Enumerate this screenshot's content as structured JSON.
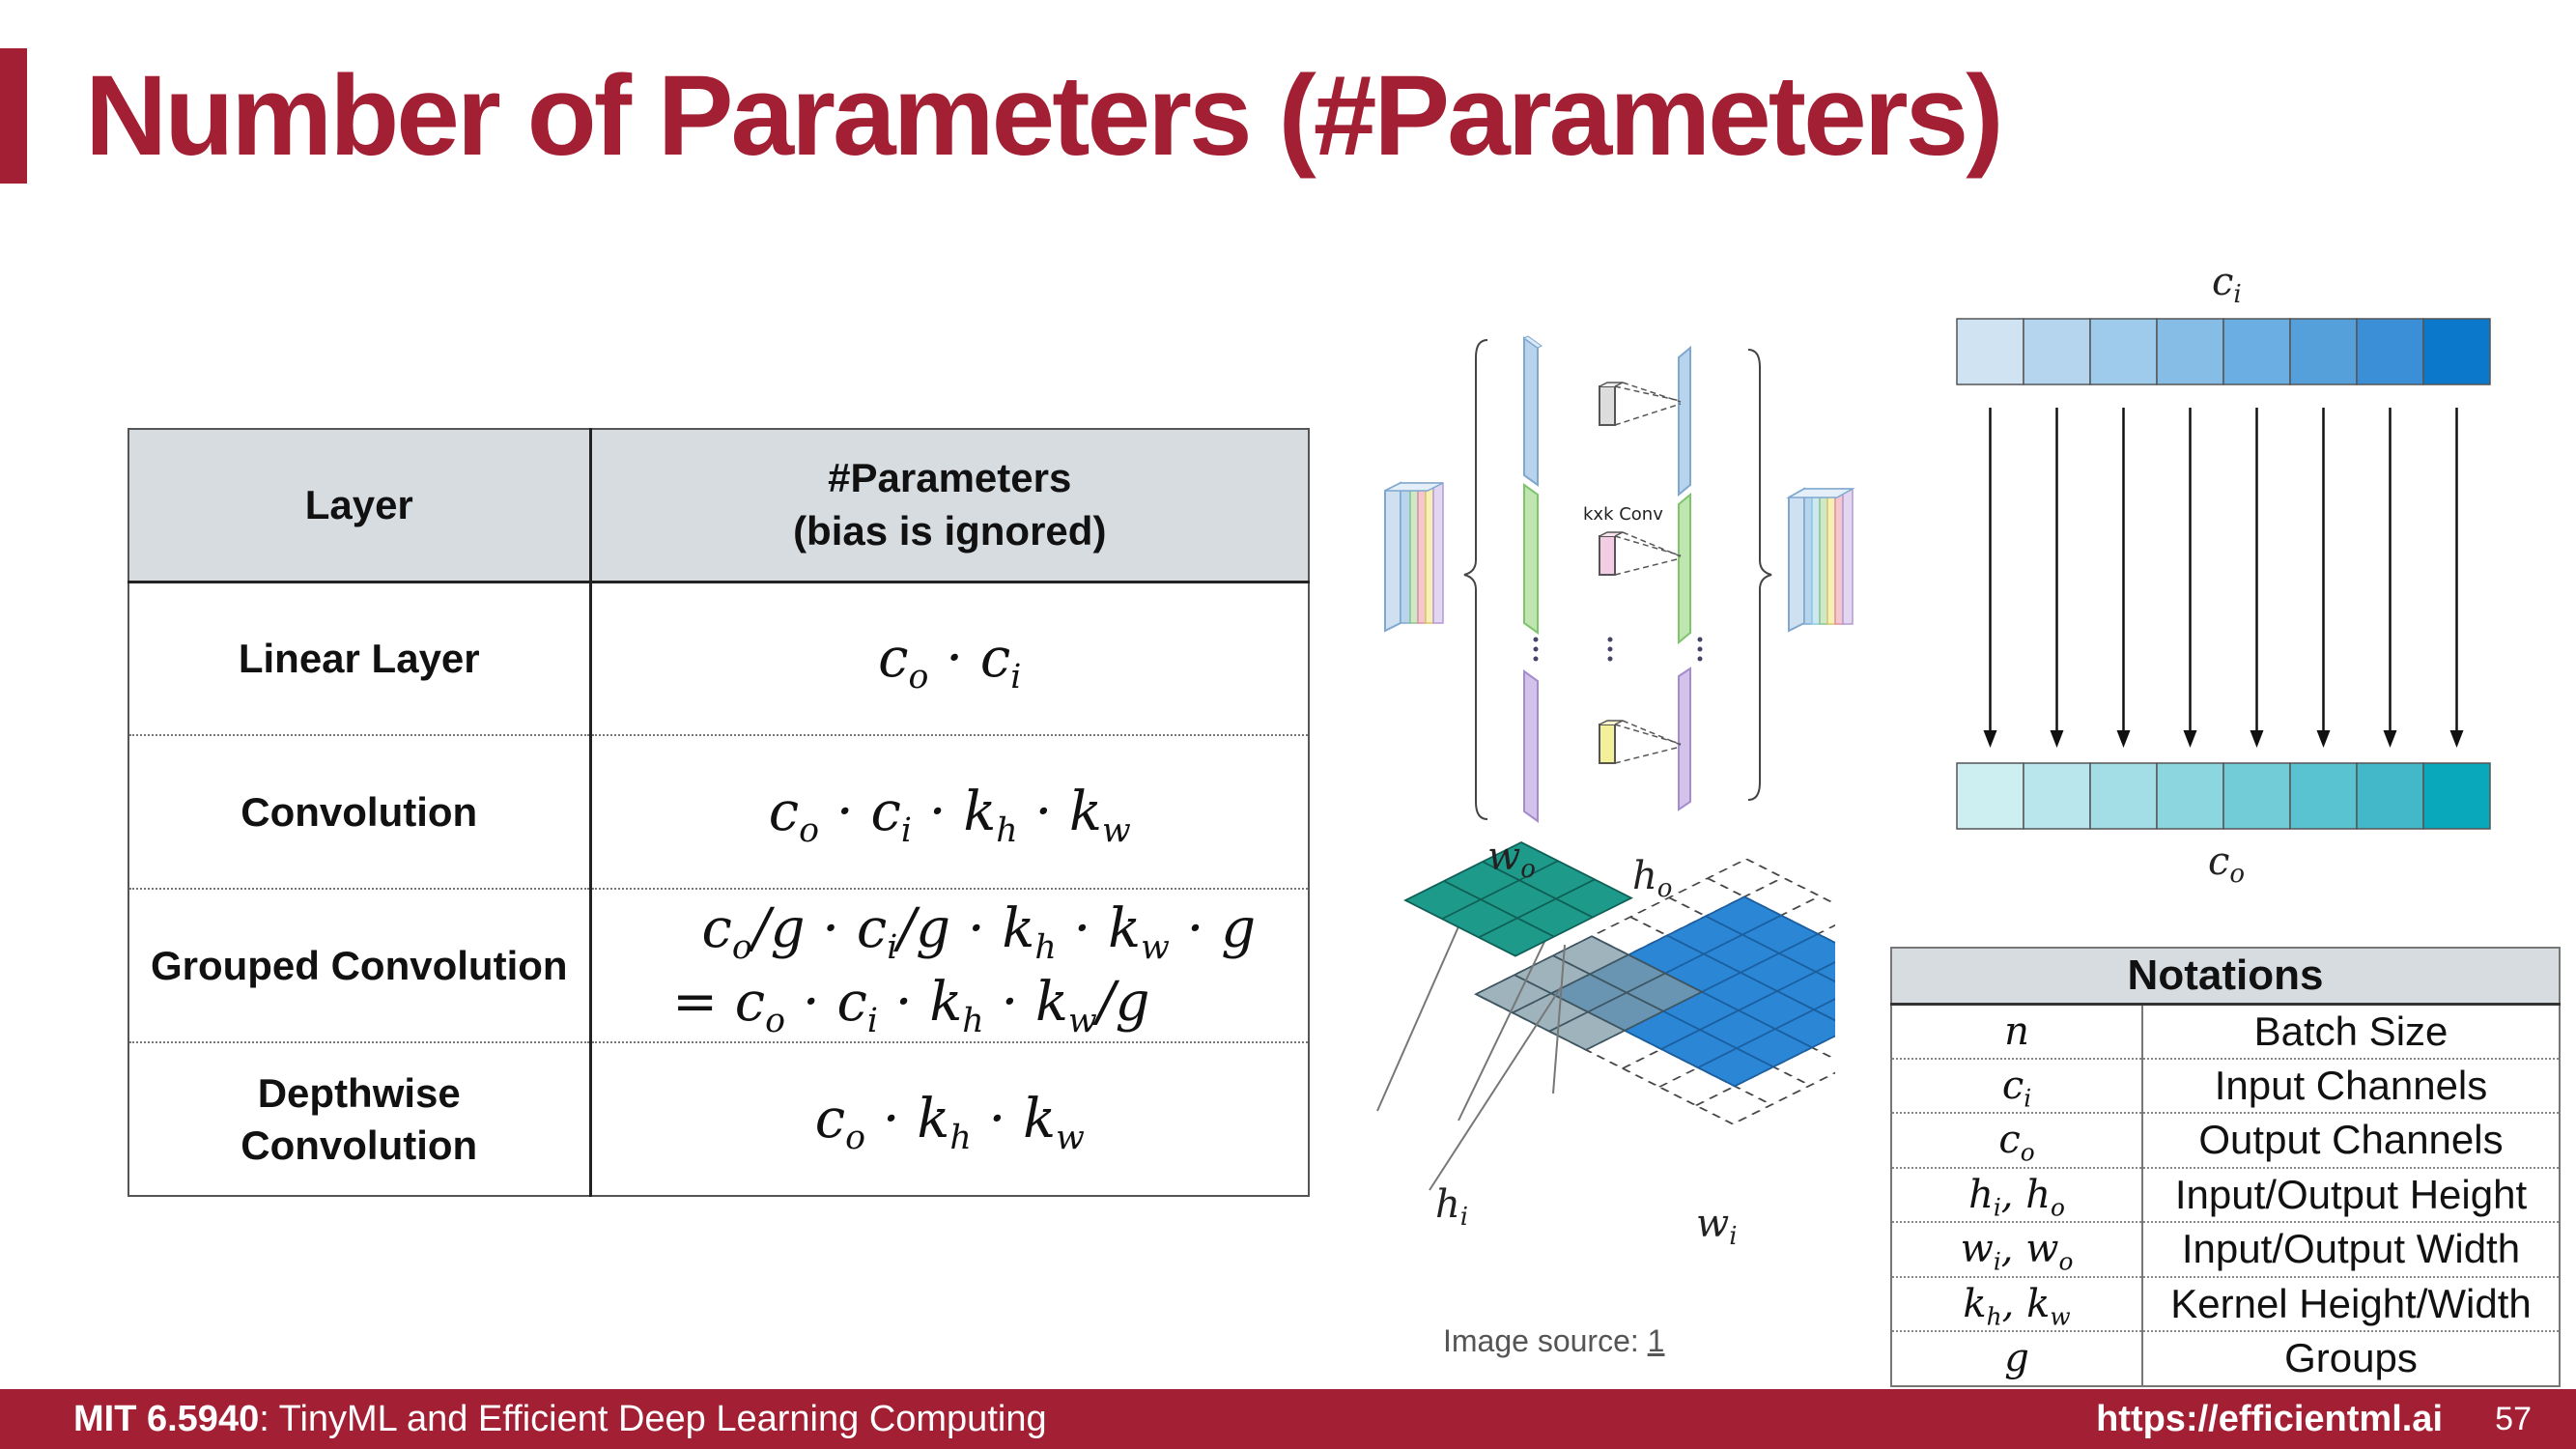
{
  "slide": {
    "title": "Number of Parameters (#Parameters)",
    "accent_color": "#a31f34"
  },
  "params_table": {
    "header": {
      "layer": "Layer",
      "params_line1": "#Parameters",
      "params_line2": "(bias is ignored)"
    },
    "rows": [
      {
        "layer": "Linear Layer",
        "formula": "co · ci"
      },
      {
        "layer": "Convolution",
        "formula": "co · ci · kh · kw"
      },
      {
        "layer": "Grouped Convolution",
        "formula_line1": "co/g · ci/g · kh · kw · g",
        "formula_line2": "= co · ci · kh · kw/g"
      },
      {
        "layer_line1": "Depthwise",
        "layer_line2": "Convolution",
        "formula": "co · kh · kw"
      }
    ]
  },
  "diagram": {
    "conv_label": "kxk Conv",
    "grid_labels": {
      "wo": "wo",
      "ho": "ho",
      "hi": "hi",
      "wi": "wi"
    },
    "linear_labels": {
      "ci": "ci",
      "co": "co"
    },
    "ci_colors": [
      "#cfe3f3",
      "#b5d5ef",
      "#9ecbec",
      "#86bde6",
      "#6aaee3",
      "#559fdb",
      "#3b8fd6",
      "#0b78cc"
    ],
    "co_colors": [
      "#cdeff1",
      "#b8e6ec",
      "#a3dde5",
      "#8cd6df",
      "#71ccd8",
      "#5ac3d1",
      "#43b8c9",
      "#0aa8bb"
    ]
  },
  "notations": {
    "title": "Notations",
    "rows": [
      {
        "symbol": "n",
        "meaning": "Batch Size"
      },
      {
        "symbol": "ci",
        "meaning": "Input Channels"
      },
      {
        "symbol": "co",
        "meaning": "Output Channels"
      },
      {
        "symbol": "hi, ho",
        "meaning": "Input/Output Height"
      },
      {
        "symbol": "wi, wo",
        "meaning": "Input/Output Width"
      },
      {
        "symbol": "kh, kw",
        "meaning": "Kernel Height/Width"
      },
      {
        "symbol": "g",
        "meaning": "Groups"
      }
    ]
  },
  "image_source": {
    "label": "Image source:",
    "link": "1"
  },
  "footer": {
    "course_code": "MIT 6.5940",
    "course_name": ": TinyML and Efficient Deep Learning Computing",
    "url": "https://efficientml.ai",
    "page": "57"
  }
}
